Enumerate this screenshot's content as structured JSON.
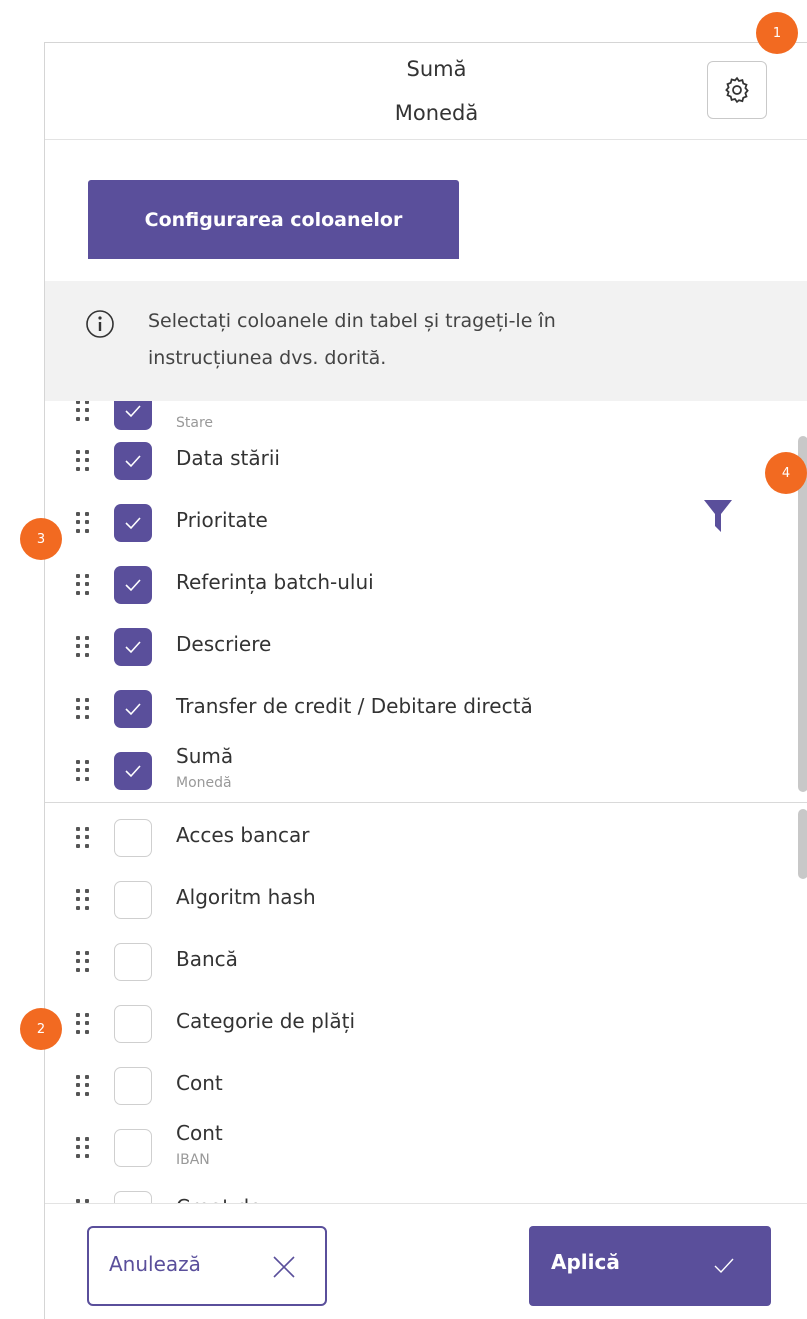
{
  "header": {
    "line1": "Sumă",
    "line2": "Monedă",
    "settings_icon": "gear-icon"
  },
  "config_tab": {
    "label": "Configurarea coloanelor"
  },
  "info": {
    "icon": "info-icon",
    "text_line1": "Selectați coloanele din tabel și trageți-le în",
    "text_line2": "instrucțiunea dvs. dorită."
  },
  "selected_columns": [
    {
      "label": "",
      "sub": "Stare",
      "checked": true
    },
    {
      "label": "Data stării",
      "checked": true
    },
    {
      "label": "Prioritate",
      "checked": true
    },
    {
      "label": "Referința batch-ului",
      "checked": true
    },
    {
      "label": "Descriere",
      "checked": true
    },
    {
      "label": "Transfer de credit / Debitare directă",
      "checked": true
    },
    {
      "label": "Sumă",
      "sub": "Monedă",
      "checked": true
    }
  ],
  "available_columns": [
    {
      "label": "Acces bancar",
      "checked": false
    },
    {
      "label": "Algoritm hash",
      "checked": false
    },
    {
      "label": "Bancă",
      "checked": false
    },
    {
      "label": "Categorie de plăți",
      "checked": false
    },
    {
      "label": "Cont",
      "checked": false
    },
    {
      "label": "Cont",
      "sub": "IBAN",
      "checked": false
    },
    {
      "label": "Creat de",
      "checked": false
    }
  ],
  "filter_icon": "filter-icon",
  "footer": {
    "cancel_label": "Anulează",
    "cancel_icon": "close-icon",
    "apply_label": "Aplică",
    "apply_icon": "check-icon"
  },
  "markers": [
    "1",
    "2",
    "3",
    "4"
  ],
  "colors": {
    "accent": "#5a4f9b",
    "marker": "#f26a21"
  }
}
